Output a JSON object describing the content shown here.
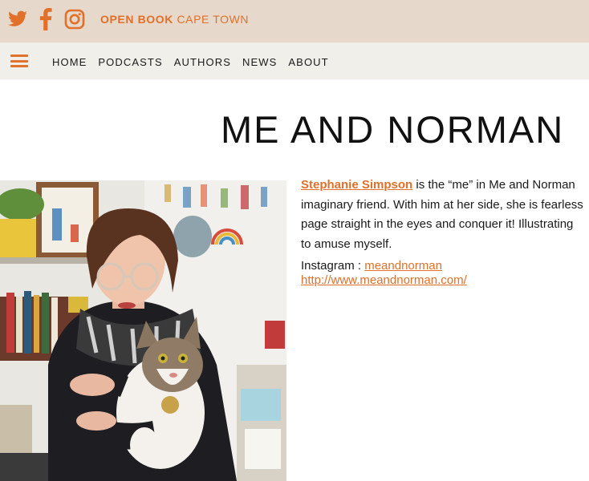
{
  "header": {
    "social": [
      {
        "icon": "twitter-icon"
      },
      {
        "icon": "facebook-icon"
      },
      {
        "icon": "instagram-icon"
      }
    ],
    "brand_bold": "OPEN BOOK",
    "brand_light": " CAPE TOWN",
    "accent_color": "#e0702a",
    "topbar_color": "#e6d8cb"
  },
  "nav": {
    "menu_icon": "hamburger-menu-icon",
    "items": [
      {
        "label": "HOME"
      },
      {
        "label": "PODCASTS"
      },
      {
        "label": "AUTHORS"
      },
      {
        "label": "NEWS"
      },
      {
        "label": "ABOUT"
      }
    ]
  },
  "page": {
    "title": "ME AND NORMAN",
    "bio": {
      "name": "Stephanie Simpson",
      "line1_rest": " is the “me” in Me and Norman",
      "line2": "imaginary friend. With him at her side, she is fearless",
      "line3": "page straight in the eyes and conquer it! Illustrating",
      "line4": "to amuse myself."
    },
    "instagram_label": "Instagram : ",
    "instagram_link": "meandnorman ",
    "website_link": " http://www.meandnorman.com/"
  }
}
